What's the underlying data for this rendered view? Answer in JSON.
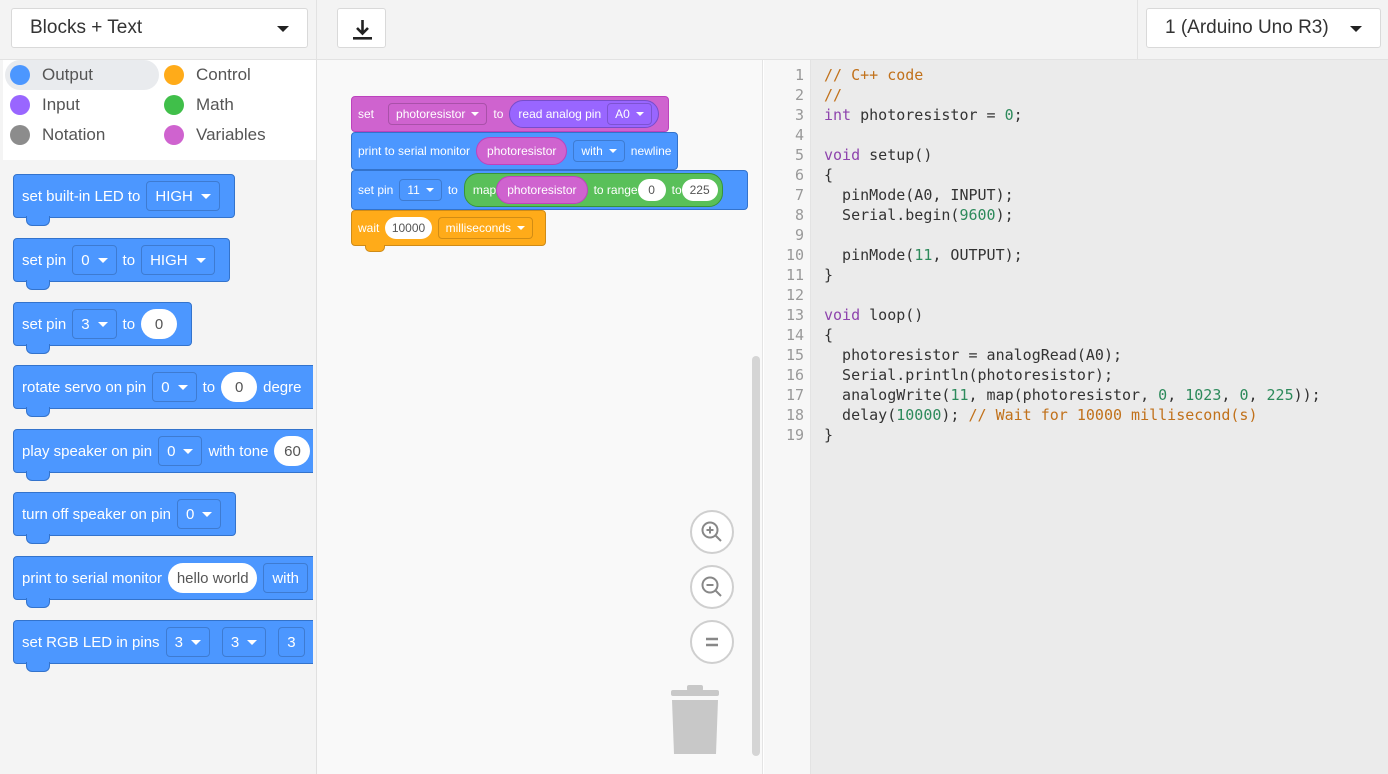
{
  "toolbar": {
    "mode_label": "Blocks + Text",
    "device_label": "1 (Arduino Uno R3)",
    "download_icon": "download-icon"
  },
  "categories": [
    {
      "label": "Output",
      "color": "#4c97ff",
      "selected": true
    },
    {
      "label": "Control",
      "color": "#ffab19"
    },
    {
      "label": "Input",
      "color": "#9966ff"
    },
    {
      "label": "Math",
      "color": "#40bf4a"
    },
    {
      "label": "Notation",
      "color": "#8c8c8c"
    },
    {
      "label": "Variables",
      "color": "#cf63cf"
    }
  ],
  "palette": {
    "b1": {
      "text": "set built-in LED to",
      "value": "HIGH"
    },
    "b2": {
      "t1": "set pin",
      "pin": "0",
      "t2": "to",
      "value": "HIGH"
    },
    "b3": {
      "t1": "set pin",
      "pin": "3",
      "t2": "to",
      "value": "0"
    },
    "b4": {
      "t1": "rotate servo on pin",
      "pin": "0",
      "t2": "to",
      "value": "0",
      "t3": "degre"
    },
    "b5": {
      "t1": "play speaker on pin",
      "pin": "0",
      "t2": "with tone",
      "value": "60"
    },
    "b6": {
      "t1": "turn off speaker on pin",
      "pin": "0"
    },
    "b7": {
      "t1": "print to serial monitor",
      "value": "hello world",
      "t2": "with"
    },
    "b8": {
      "t1": "set RGB LED in pins",
      "p1": "3",
      "p2": "3",
      "p3": "3"
    }
  },
  "workspace": {
    "s1": {
      "t1": "set",
      "var": "photoresistor",
      "t2": "to",
      "t3": "read analog pin",
      "pin": "A0"
    },
    "s2": {
      "t1": "print to serial monitor",
      "var": "photoresistor",
      "opt": "with",
      "t2": "newline"
    },
    "s3": {
      "t1": "set pin",
      "pin": "11",
      "t2": "to",
      "t3": "map",
      "var": "photoresistor",
      "t4": "to range",
      "lo": "0",
      "t5": "to",
      "hi": "225"
    },
    "s4": {
      "t1": "wait",
      "value": "10000",
      "unit": "milliseconds"
    }
  },
  "code": {
    "line_numbers": [
      "1",
      "2",
      "3",
      "4",
      "5",
      "6",
      "7",
      "8",
      "9",
      "10",
      "11",
      "12",
      "13",
      "14",
      "15",
      "16",
      "17",
      "18",
      "19"
    ],
    "l1": "// C++ code",
    "l2": "//",
    "l3a": "int",
    "l3b": " photoresistor = ",
    "l3c": "0",
    "l3d": ";",
    "l5a": "void",
    "l5b": " setup()",
    "l6": "{",
    "l7": "  pinMode(A0, INPUT);",
    "l8a": "  Serial.begin(",
    "l8b": "9600",
    "l8c": ");",
    "l10a": "  pinMode(",
    "l10b": "11",
    "l10c": ", OUTPUT);",
    "l11": "}",
    "l13a": "void",
    "l13b": " loop()",
    "l14": "{",
    "l15": "  photoresistor = analogRead(A0);",
    "l16": "  Serial.println(photoresistor);",
    "l17a": "  analogWrite(",
    "l17b": "11",
    "l17c": ", map(photoresistor, ",
    "l17d": "0",
    "l17e": ", ",
    "l17f": "1023",
    "l17g": ", ",
    "l17h": "0",
    "l17i": ", ",
    "l17j": "225",
    "l17k": "));",
    "l18a": "  delay(",
    "l18b": "10000",
    "l18c": "); ",
    "l18d": "// Wait for 10000 millisecond(s)",
    "l19": "}"
  },
  "colors": {
    "output": "#4c97ff",
    "control": "#ffab19",
    "math": "#59c059",
    "variables": "#cf63cf",
    "input": "#9966ff"
  }
}
